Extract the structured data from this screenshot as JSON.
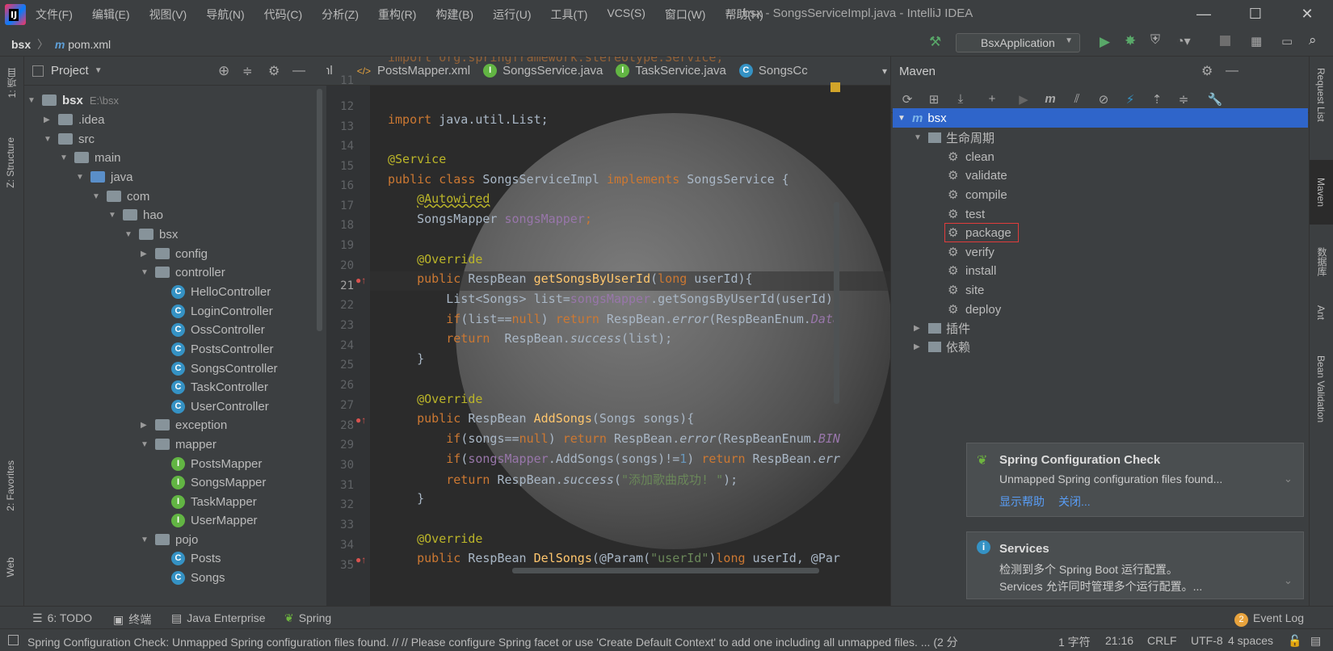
{
  "app": {
    "window_title": "bsx - SongsServiceImpl.java - IntelliJ IDEA"
  },
  "menu": [
    "文件(F)",
    "编辑(E)",
    "视图(V)",
    "导航(N)",
    "代码(C)",
    "分析(Z)",
    "重构(R)",
    "构建(B)",
    "运行(U)",
    "工具(T)",
    "VCS(S)",
    "窗口(W)",
    "帮助(H)"
  ],
  "breadcrumb": {
    "project": "bsx",
    "file": "pom.xml"
  },
  "run_config": "BsxApplication",
  "left_strip": {
    "project_tab": "1: 项目",
    "structure_tab": "Z: Structure",
    "favorites_tab": "2: Favorites",
    "web_tab": "Web"
  },
  "project_panel": {
    "title": "Project",
    "root_name": "bsx",
    "root_path": "E:\\bsx",
    "items": [
      {
        "label": ".idea"
      },
      {
        "label": "src"
      },
      {
        "label": "main"
      },
      {
        "label": "java"
      },
      {
        "label": "com"
      },
      {
        "label": "hao"
      },
      {
        "label": "bsx"
      },
      {
        "label": "config"
      },
      {
        "label": "controller"
      },
      {
        "label": "HelloController"
      },
      {
        "label": "LoginController"
      },
      {
        "label": "OssController"
      },
      {
        "label": "PostsController"
      },
      {
        "label": "SongsController"
      },
      {
        "label": "TaskController"
      },
      {
        "label": "UserController"
      },
      {
        "label": "exception"
      },
      {
        "label": "mapper"
      },
      {
        "label": "PostsMapper"
      },
      {
        "label": "SongsMapper"
      },
      {
        "label": "TaskMapper"
      },
      {
        "label": "UserMapper"
      },
      {
        "label": "pojo"
      },
      {
        "label": "Posts"
      },
      {
        "label": "Songs"
      }
    ]
  },
  "editor_tabs": [
    "nl",
    "PostsMapper.xml",
    "SongsService.java",
    "TaskService.java",
    "SongsCc"
  ],
  "editor": {
    "line_numbers": [
      "11",
      "12",
      "13",
      "14",
      "15",
      "16",
      "17",
      "18",
      "19",
      "20",
      "21",
      "22",
      "23",
      "24",
      "25",
      "26",
      "27",
      "28",
      "29",
      "30",
      "31",
      "32",
      "33",
      "34",
      "35"
    ],
    "l11": "import org.springframework.stereotype.Service;",
    "l13a": "import",
    "l13b": " java.util.List;",
    "l15": "@Service",
    "l16a": "public class",
    "l16b": " SongsServiceImpl ",
    "l16c": "implements",
    "l16d": " SongsService {",
    "l17": "@Autowired",
    "l18a": "SongsMapper ",
    "l18b": "songsMapper",
    "l18c": ";",
    "l20": "@Override",
    "l21a": "public",
    "l21b": " RespBean ",
    "l21c": "getSongsByUserId",
    "l21d": "(",
    "l21e": "long",
    "l21f": " userId){",
    "l22a": "List<Songs> list=",
    "l22b": "songsMapper",
    "l22c": ".getSongsByUserId(userId);",
    "l23a": "if",
    "l23b": "(list==",
    "l23c": "null",
    "l23d": ") ",
    "l23e": "return",
    "l23f": " RespBean.",
    "l23g": "error",
    "l23h": "(RespBeanEnum.",
    "l23i": "Data",
    "l24a": "return",
    "l24b": "  RespBean.",
    "l24c": "success",
    "l24d": "(list);",
    "l25": "}",
    "l27": "@Override",
    "l28a": "public",
    "l28b": " RespBean ",
    "l28c": "AddSongs",
    "l28d": "(Songs songs){",
    "l29a": "if",
    "l29b": "(songs==",
    "l29c": "null",
    "l29d": ") ",
    "l29e": "return",
    "l29f": " RespBean.",
    "l29g": "error",
    "l29h": "(RespBeanEnum.",
    "l29i": "BIN",
    "l30a": "if",
    "l30b": "(",
    "l30c": "songsMapper",
    "l30d": ".AddSongs(songs)!=",
    "l30e": "1",
    "l30f": ") ",
    "l30g": "return",
    "l30h": " RespBean.",
    "l30i": "err",
    "l31a": "return",
    "l31b": " RespBean.",
    "l31c": "success",
    "l31d": "(",
    "l31e": "\"添加歌曲成功! \"",
    "l31f": ");",
    "l32": "}",
    "l34": "@Override",
    "l35a": "public",
    "l35b": " RespBean ",
    "l35c": "DelSongs",
    "l35d": "(@Param(",
    "l35e": "\"userId\"",
    "l35f": ")",
    "l35g": "long",
    "l35h": " userId, @Par"
  },
  "maven": {
    "title": "Maven",
    "root": "bsx",
    "lifecycle": "生命周期",
    "phases": [
      "clean",
      "validate",
      "compile",
      "test",
      "package",
      "verify",
      "install",
      "site",
      "deploy"
    ],
    "plugins": "插件",
    "dependencies": "依赖"
  },
  "right_strip": {
    "request_list": "Request List",
    "maven_tab": "Maven",
    "database_tab": "数据库",
    "ant_tab": "Ant",
    "bean_validation": "Bean Validation"
  },
  "notifications": {
    "spring": {
      "title": "Spring Configuration Check",
      "body": "Unmapped Spring configuration files found...",
      "link_help": "显示帮助",
      "link_close": "关闭..."
    },
    "services": {
      "title": "Services",
      "line1": "检测到多个 Spring Boot 运行配置。",
      "line2": "Services 允许同时管理多个运行配置。..."
    }
  },
  "tool_windows": {
    "todo": "6: TODO",
    "terminal": "终端",
    "java_enterprise": "Java Enterprise",
    "spring": "Spring",
    "event_log": "Event Log",
    "event_count": "2"
  },
  "status_bar": {
    "message": "Spring Configuration Check: Unmapped Spring configuration files found. // // Please configure Spring facet or use 'Create Default Context' to add one including all unmapped files. ... (2 分",
    "chars": "1 字符",
    "position": "21:16",
    "line_sep": "CRLF",
    "encoding": "UTF-8",
    "indent": "4 spaces"
  },
  "colors": {
    "bg": "#2b2b2b",
    "panel": "#3c3f41",
    "selection": "#2f65ca",
    "highlight_box": "#e03c3c"
  }
}
